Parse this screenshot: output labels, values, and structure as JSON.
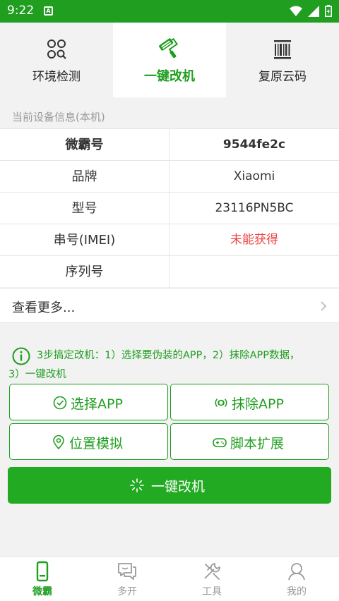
{
  "status_bar": {
    "time": "9:22",
    "a_badge": "A"
  },
  "tabs": [
    {
      "label": "环境检测",
      "icon": "circles-search-icon",
      "active": false
    },
    {
      "label": "一键改机",
      "icon": "paint-roller-icon",
      "active": true
    },
    {
      "label": "复原云码",
      "icon": "barcode-icon",
      "active": false
    }
  ],
  "device_info": {
    "section_title": "当前设备信息(本机)",
    "rows": [
      {
        "key": "微霸号",
        "value": "9544fe2c"
      },
      {
        "key": "品牌",
        "value": "Xiaomi"
      },
      {
        "key": "型号",
        "value": "23116PN5BC"
      },
      {
        "key": "串号(IMEI)",
        "value": "未能获得"
      },
      {
        "key": "序列号",
        "value": ""
      }
    ],
    "more_label": "查看更多..."
  },
  "tip": {
    "line1": "3步搞定改机：1）选择要伪装的APP，2）抹除APP数据，",
    "line2": "3）一键改机"
  },
  "actions": {
    "select_app": "选择APP",
    "erase_app": "抹除APP",
    "location": "位置模拟",
    "script": "脚本扩展",
    "one_click": "一键改机"
  },
  "bottom_nav": [
    {
      "label": "微霸",
      "icon": "phone-icon",
      "active": true
    },
    {
      "label": "多开",
      "icon": "chat-icon",
      "active": false
    },
    {
      "label": "工具",
      "icon": "tools-icon",
      "active": false
    },
    {
      "label": "我的",
      "icon": "person-icon",
      "active": false
    }
  ],
  "colors": {
    "accent": "#1f9e1f",
    "primary_button": "#22aa22",
    "warning": "#ee4444",
    "background": "#f2f2f2"
  }
}
